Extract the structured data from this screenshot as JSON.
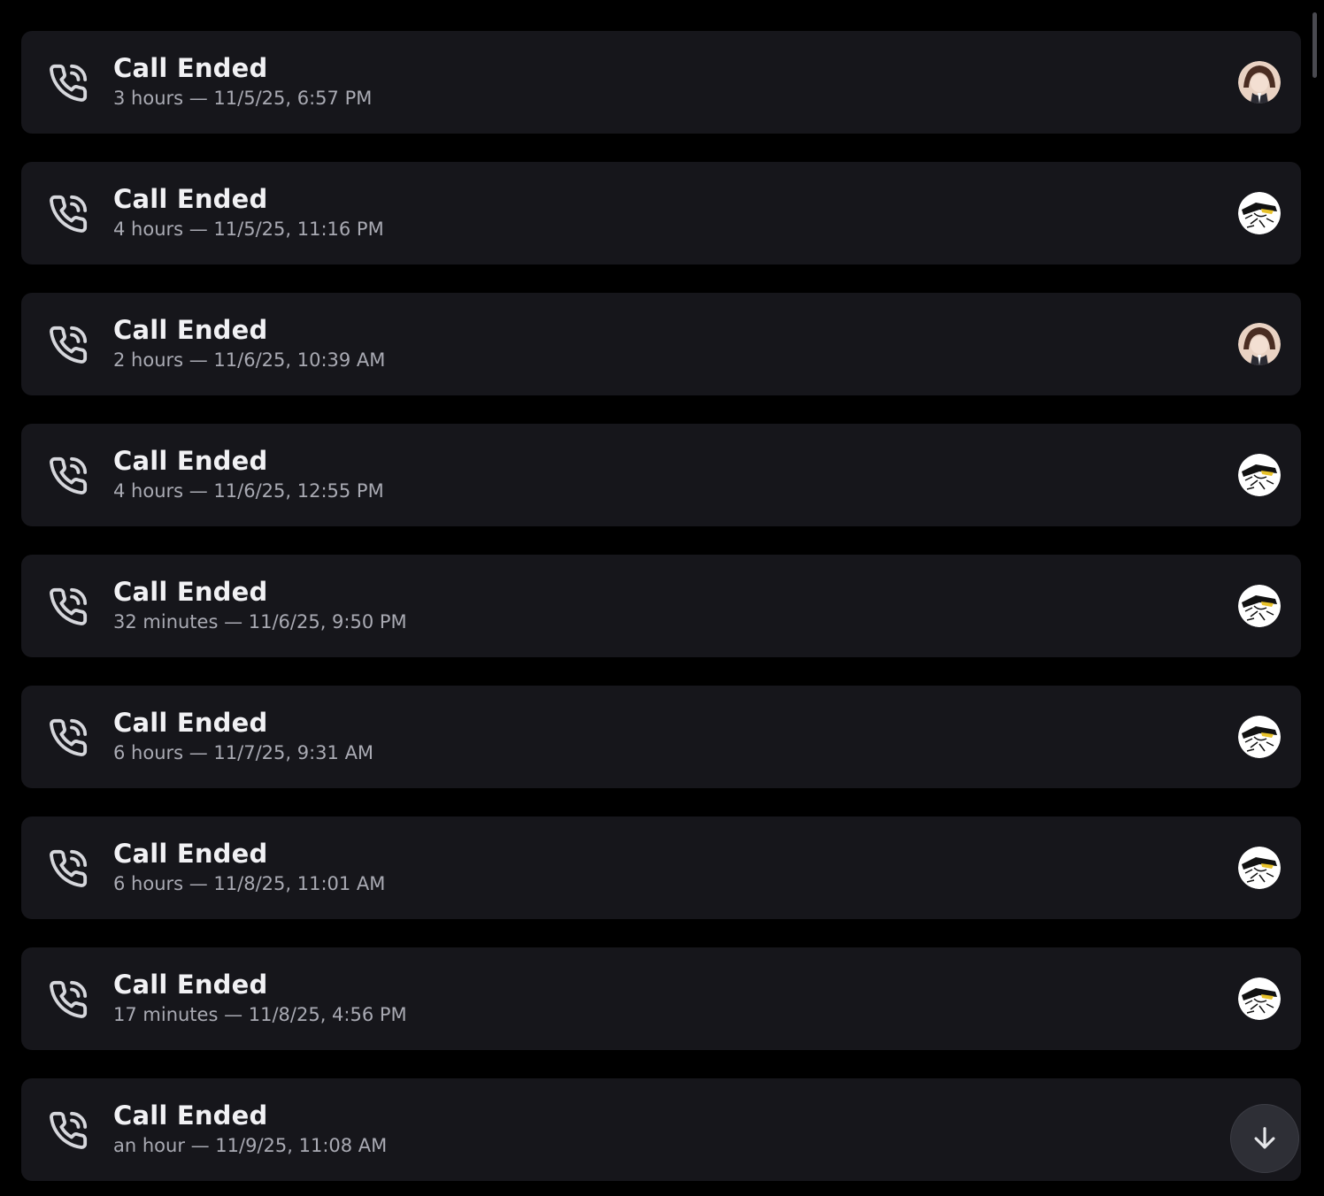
{
  "calls": [
    {
      "title": "Call Ended",
      "subtitle": "3 hours — 11/5/25, 6:57 PM",
      "avatar": "girl"
    },
    {
      "title": "Call Ended",
      "subtitle": "4 hours — 11/5/25, 11:16 PM",
      "avatar": "manga"
    },
    {
      "title": "Call Ended",
      "subtitle": "2 hours — 11/6/25, 10:39 AM",
      "avatar": "girl"
    },
    {
      "title": "Call Ended",
      "subtitle": "4 hours — 11/6/25, 12:55 PM",
      "avatar": "manga"
    },
    {
      "title": "Call Ended",
      "subtitle": "32 minutes — 11/6/25, 9:50 PM",
      "avatar": "manga"
    },
    {
      "title": "Call Ended",
      "subtitle": "6 hours — 11/7/25, 9:31 AM",
      "avatar": "manga"
    },
    {
      "title": "Call Ended",
      "subtitle": "6 hours — 11/8/25, 11:01 AM",
      "avatar": "manga"
    },
    {
      "title": "Call Ended",
      "subtitle": "17 minutes — 11/8/25, 4:56 PM",
      "avatar": "manga"
    },
    {
      "title": "Call Ended",
      "subtitle": "an hour — 11/9/25, 11:08 AM",
      "avatar": "none"
    }
  ],
  "icons": {
    "call": "phone-call-icon",
    "jump": "arrow-down-icon"
  },
  "colors": {
    "background": "#000000",
    "card": "#16161b",
    "title": "#f1f1f4",
    "subtitle": "#a9aab3"
  }
}
